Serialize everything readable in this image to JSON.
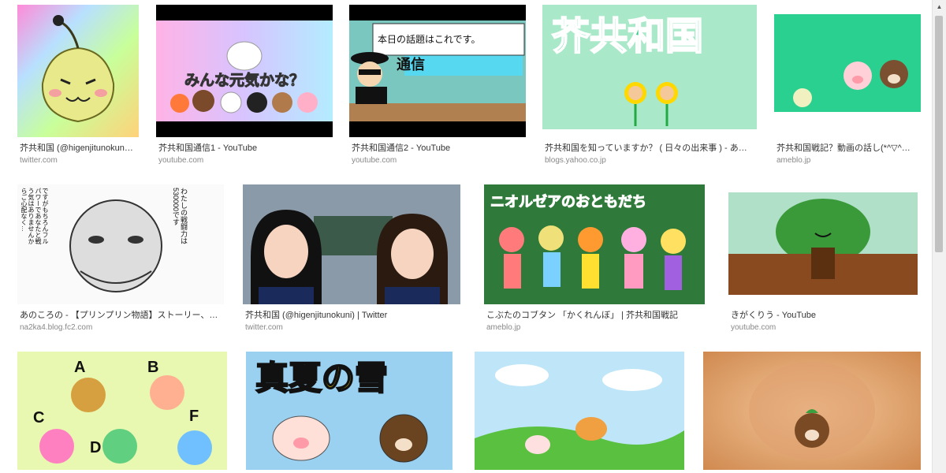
{
  "results": [
    {
      "caption": "芥共和国 (@higenjitunokun…",
      "source": "twitter.com"
    },
    {
      "caption": "芥共和国通信1 - YouTube",
      "source": "youtube.com",
      "overlay": "みんな元気かな？"
    },
    {
      "caption": "芥共和国通信2 - YouTube",
      "source": "youtube.com",
      "overlay": "本日の話題はこれです。",
      "overlay2": "通信"
    },
    {
      "caption": "芥共和国を知っていますか？ ( 日々の出来事 ) - あ…",
      "source": "blogs.yahoo.co.jp",
      "overlay": "芥共和国"
    },
    {
      "caption": "芥共和国戦記？動画の話し(*^▽^…",
      "source": "ameblo.jp"
    },
    {
      "caption": "あのころの - 【プリンプリン物語】ストーリー、…",
      "source": "na2ka4.blog.fc2.com",
      "overlay": "わたしの戦闘力は530000です",
      "overlay2": "ですがもちろんフルパワーであなたと戦う気はありませんからご心配なく…"
    },
    {
      "caption": "芥共和国 (@higenjitunokuni) | Twitter",
      "source": "twitter.com"
    },
    {
      "caption": "こぶたのコブタン 「かくれんぼ」 | 芥共和国戦記",
      "source": "ameblo.jp",
      "overlay": "ニオルゼアのおともだち"
    },
    {
      "caption": "きがくりう - YouTube",
      "source": "youtube.com"
    },
    {
      "caption": "",
      "source": "",
      "letters": [
        "A",
        "B",
        "C",
        "D",
        "F"
      ]
    },
    {
      "caption": "",
      "source": "",
      "overlay": "真夏の雪"
    },
    {
      "caption": "",
      "source": ""
    },
    {
      "caption": "",
      "source": ""
    }
  ],
  "scrollbar": {
    "up_arrow": "▲"
  }
}
